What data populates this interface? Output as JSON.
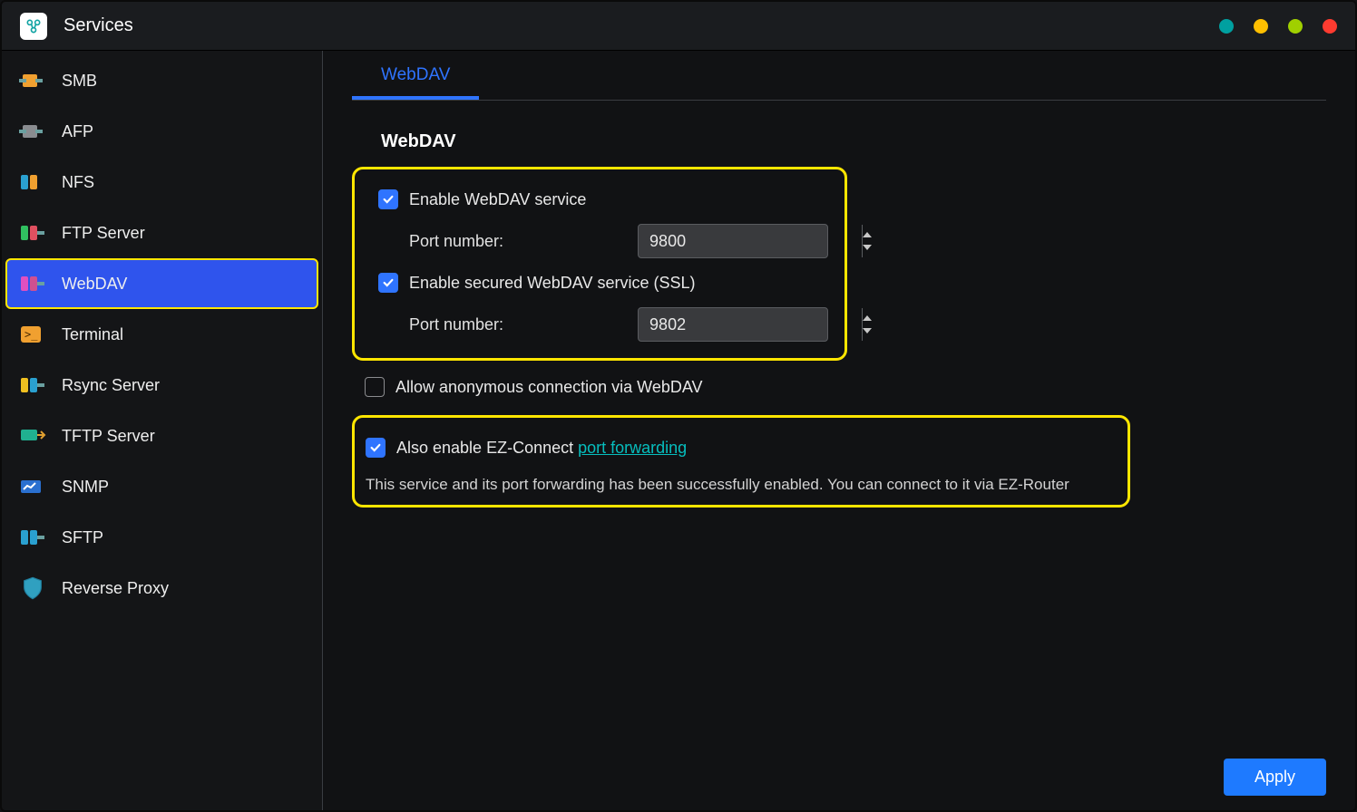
{
  "header": {
    "title": "Services"
  },
  "dots": [
    "#00a0a0",
    "#ffbf00",
    "#a0d000",
    "#ff3b30"
  ],
  "sidebar": {
    "items": [
      {
        "label": "SMB"
      },
      {
        "label": "AFP"
      },
      {
        "label": "NFS"
      },
      {
        "label": "FTP Server"
      },
      {
        "label": "WebDAV"
      },
      {
        "label": "Terminal"
      },
      {
        "label": "Rsync Server"
      },
      {
        "label": "TFTP Server"
      },
      {
        "label": "SNMP"
      },
      {
        "label": "SFTP"
      },
      {
        "label": "Reverse Proxy"
      }
    ],
    "selected_index": 4
  },
  "tab": {
    "label": "WebDAV"
  },
  "section": {
    "title": "WebDAV",
    "enable_webdav": {
      "label": "Enable WebDAV service",
      "checked": true,
      "port_label": "Port number:",
      "port_value": "9800"
    },
    "enable_ssl": {
      "label": "Enable secured WebDAV service (SSL)",
      "checked": true,
      "port_label": "Port number:",
      "port_value": "9802"
    },
    "allow_anon": {
      "label": "Allow anonymous connection via WebDAV",
      "checked": false
    },
    "ez_connect": {
      "checked": true,
      "label_prefix": "Also enable EZ-Connect ",
      "link_text": "port forwarding",
      "note": "This service and its port forwarding has been successfully enabled. You can connect to it via EZ-Router"
    }
  },
  "footer": {
    "apply": "Apply"
  }
}
